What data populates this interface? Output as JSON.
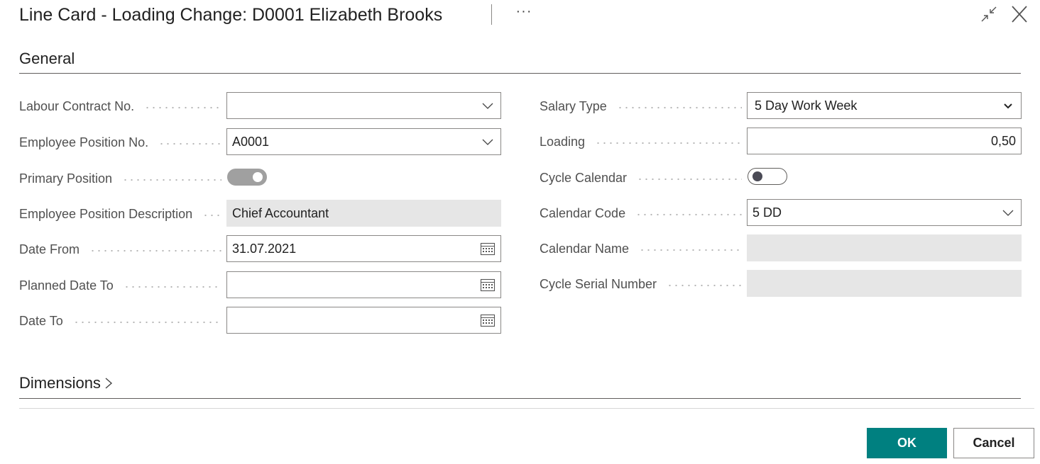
{
  "header": {
    "title": "Line Card - Loading Change: D0001 Elizabeth Brooks",
    "more_label": "···",
    "collapse_icon": "collapse-icon",
    "close_icon": "close-icon"
  },
  "general": {
    "title": "General",
    "left": [
      {
        "label": "Labour Contract No.",
        "value": "",
        "control": "dropdown"
      },
      {
        "label": "Employee Position No.",
        "value": "A0001",
        "control": "dropdown"
      },
      {
        "label": "Primary Position",
        "value": "on",
        "control": "toggle"
      },
      {
        "label": "Employee Position Description",
        "value": "Chief Accountant",
        "control": "readonly"
      },
      {
        "label": "Date From",
        "value": "31.07.2021",
        "control": "date"
      },
      {
        "label": "Planned Date To",
        "value": "",
        "control": "date"
      },
      {
        "label": "Date To",
        "value": "",
        "control": "date"
      }
    ],
    "right": [
      {
        "label": "Salary Type",
        "value": "5 Day Work Week",
        "control": "select"
      },
      {
        "label": "Loading",
        "value": "0,50",
        "control": "number"
      },
      {
        "label": "Cycle Calendar",
        "value": "off",
        "control": "toggle"
      },
      {
        "label": "Calendar Code",
        "value": "5 DD",
        "control": "dropdown"
      },
      {
        "label": "Calendar Name",
        "value": "",
        "control": "readonly"
      },
      {
        "label": "Cycle Serial Number",
        "value": "",
        "control": "readonly"
      }
    ]
  },
  "dimensions": {
    "title": "Dimensions"
  },
  "footer": {
    "ok_label": "OK",
    "cancel_label": "Cancel"
  },
  "colors": {
    "accent": "#008080",
    "readonly_bg": "#e6e6e6",
    "border": "#8a8886"
  }
}
